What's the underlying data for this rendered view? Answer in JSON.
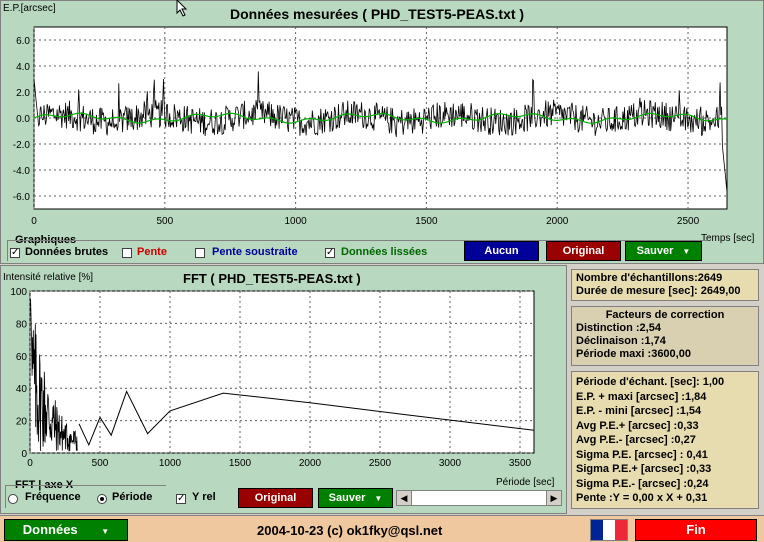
{
  "top_chart": {
    "title": "Données mesurées ( PHD_TEST5-PEAS.txt )",
    "y_unit_label": "E.P.[arcsec]",
    "x_unit_label": "Temps [sec]",
    "y_ticks": [
      "6.0",
      "4.0",
      "2.0",
      "0.0",
      "-2.0",
      "-4.0",
      "-6.0"
    ],
    "x_ticks": [
      "0",
      "500",
      "1000",
      "1500",
      "2000",
      "2500"
    ]
  },
  "graphiques": {
    "group_label": "Graphiques",
    "raw_data": {
      "label": "Données brutes",
      "checked": true,
      "color": "#000000"
    },
    "slope": {
      "label": "Pente",
      "checked": false,
      "color": "#cc0000"
    },
    "slope_removed": {
      "label": "Pente soustraite",
      "checked": false,
      "color": "#000099"
    },
    "smoothed": {
      "label": "Données lissées",
      "checked": true,
      "color": "#006600"
    },
    "aucun_label": "Aucun",
    "original_label": "Original",
    "sauver_label": "Sauver"
  },
  "fft_chart": {
    "title": "FFT ( PHD_TEST5-PEAS.txt )",
    "y_unit_label": "Intensité relative [%]",
    "x_unit_label": "Période [sec]",
    "y_ticks": [
      "100",
      "80",
      "60",
      "40",
      "20",
      "0"
    ],
    "x_ticks": [
      "0",
      "500",
      "1000",
      "1500",
      "2000",
      "2500",
      "3000",
      "3500"
    ]
  },
  "fft_controls": {
    "axis_group_label": "FFT  |  axe X",
    "frequence_label": "Fréquence",
    "periode_label": "Période",
    "selected_axis": "periode",
    "yrel_label": "Y rel",
    "yrel_checked": true,
    "original_label": "Original",
    "sauver_label": "Sauver"
  },
  "info_samples": {
    "line1": "Nombre d'échantillons:2649",
    "line2": "Durée de mesure [sec]: 2649,00"
  },
  "info_correction": {
    "title": "Facteurs de correction",
    "line1": "Distinction :2,54",
    "line2": "Déclinaison :1,74",
    "line3": "Période maxi :3600,00"
  },
  "info_stats": {
    "lines": [
      "Période d'échant. [sec]: 1,00",
      "E.P. + maxi [arcsec] :1,84",
      "E.P. - mini [arcsec] :1,54",
      "Avg P.E.+ [arcsec] :0,33",
      "Avg P.E.- [arcsec] :0,27",
      "Sigma P.E. [arcsec] : 0,41",
      "Sigma P.E.+ [arcsec] :0,33",
      "Sigma P.E.- [arcsec] :0,24",
      "Pente :Y = 0,00 x X + 0,31"
    ]
  },
  "footer": {
    "donnees_label": "Données",
    "copyright": "2004-10-23 (c) ok1fky@qsl.net",
    "fin_label": "Fin"
  },
  "colors": {
    "panel_green": "#b8d8c0",
    "info_yellow": "#e6dcb0",
    "info_gray": "#d8d0b0",
    "footer_peach": "#f0c8a0",
    "btn_blue": "#000099",
    "btn_red": "#990000",
    "btn_green": "#008000",
    "fin_red": "#ff0000",
    "smooth_green": "#00b000"
  },
  "chart_data": [
    {
      "type": "line",
      "title": "Données mesurées ( PHD_TEST5-PEAS.txt )",
      "xlabel": "Temps [sec]",
      "ylabel": "E.P.[arcsec]",
      "xlim": [
        0,
        2649
      ],
      "ylim": [
        -7,
        7
      ],
      "grid": true,
      "series": [
        {
          "name": "Données brutes",
          "samples": 2649,
          "range": [
            -5.8,
            4.3
          ]
        },
        {
          "name": "Données lissées",
          "samples": 2649,
          "level": 0.0
        }
      ],
      "x_ticks": [
        0,
        500,
        1000,
        1500,
        2000,
        2500
      ],
      "y_ticks": [
        6,
        4,
        2,
        0,
        -2,
        -4,
        -6
      ]
    },
    {
      "type": "line",
      "title": "FFT ( PHD_TEST5-PEAS.txt )",
      "xlabel": "Période [sec]",
      "ylabel": "Intensité relative [%]",
      "xlim": [
        0,
        3600
      ],
      "ylim": [
        0,
        100
      ],
      "grid": true,
      "series": [
        {
          "x": [
            350,
            420,
            500,
            580,
            690,
            840,
            1000,
            1380,
            2000,
            2650,
            3600
          ],
          "y": [
            18,
            5,
            22,
            11,
            38,
            12,
            26,
            37,
            31,
            24,
            14
          ]
        }
      ],
      "x_ticks": [
        0,
        500,
        1000,
        1500,
        2000,
        2500,
        3000,
        3500
      ],
      "y_ticks": [
        0,
        20,
        40,
        60,
        80,
        100
      ]
    }
  ]
}
